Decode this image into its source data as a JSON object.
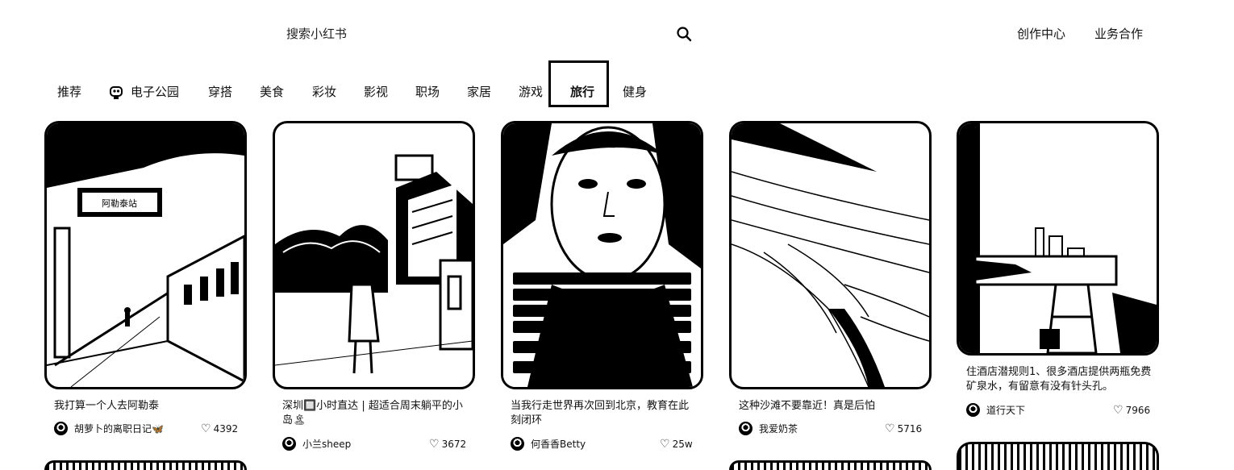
{
  "header": {
    "search_placeholder": "搜索小红书",
    "links": [
      "创作中心",
      "业务合作"
    ]
  },
  "categories": [
    "推荐",
    "电子公园",
    "穿搭",
    "美食",
    "彩妆",
    "影视",
    "职场",
    "家居",
    "游戏",
    "旅行",
    "健身"
  ],
  "active_category": "旅行",
  "cards": [
    {
      "title": "我打算一个人去阿勒泰",
      "author": "胡萝卜的离职日记🦋",
      "likes": "4392",
      "sign_text": "阿勒泰站"
    },
    {
      "title": "深圳🔲小时直达 | 超适合周末躺平的小岛🏝",
      "author": "小兰sheep",
      "likes": "3672"
    },
    {
      "title": "当我行走世界再次回到北京，教育在此刻闭环",
      "author": "何香香Betty",
      "likes": "25w"
    },
    {
      "title": "这种沙滩不要靠近！真是后怕",
      "author": "我爱奶茶",
      "likes": "5716"
    },
    {
      "title": "住酒店潜规则1、很多酒店提供两瓶免费矿泉水，有留意有没有针头孔。",
      "author": "道行天下",
      "likes": "7966"
    }
  ]
}
